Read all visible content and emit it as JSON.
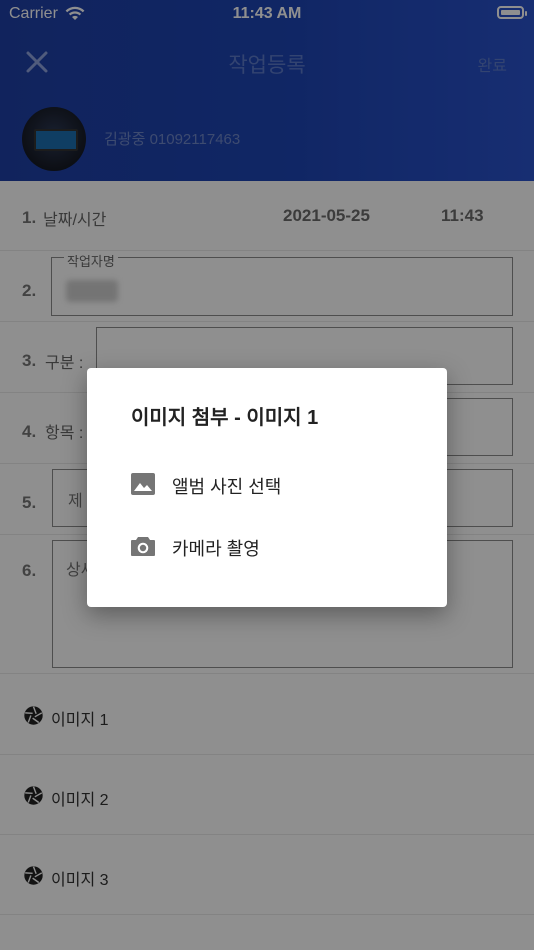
{
  "status_bar": {
    "carrier": "Carrier",
    "time": "11:43 AM"
  },
  "header": {
    "title": "작업등록",
    "done": "완료",
    "user": "김광중 01092117463"
  },
  "form": {
    "row1": {
      "num": "1.",
      "label": "날짜/시간",
      "date": "2021-05-25",
      "time": "11:43"
    },
    "row2": {
      "num": "2.",
      "legend": "작업자명"
    },
    "row3": {
      "num": "3.",
      "label": "구분 :"
    },
    "row4": {
      "num": "4.",
      "label": "항목 :"
    },
    "row5": {
      "num": "5.",
      "partial": "제"
    },
    "row6": {
      "num": "6.",
      "partial": "상세"
    }
  },
  "images": [
    {
      "label": "이미지 1"
    },
    {
      "label": "이미지 2"
    },
    {
      "label": "이미지 3"
    }
  ],
  "dialog": {
    "title": "이미지 첨부 - 이미지 1",
    "options": [
      {
        "label": "앨범 사진 선택",
        "icon": "image-icon"
      },
      {
        "label": "카메라 촬영",
        "icon": "camera-icon"
      }
    ]
  },
  "colors": {
    "header_start": "#1f3fa6",
    "header_end": "#2a52cc",
    "overlay": "rgba(0,0,0,0.44)"
  }
}
